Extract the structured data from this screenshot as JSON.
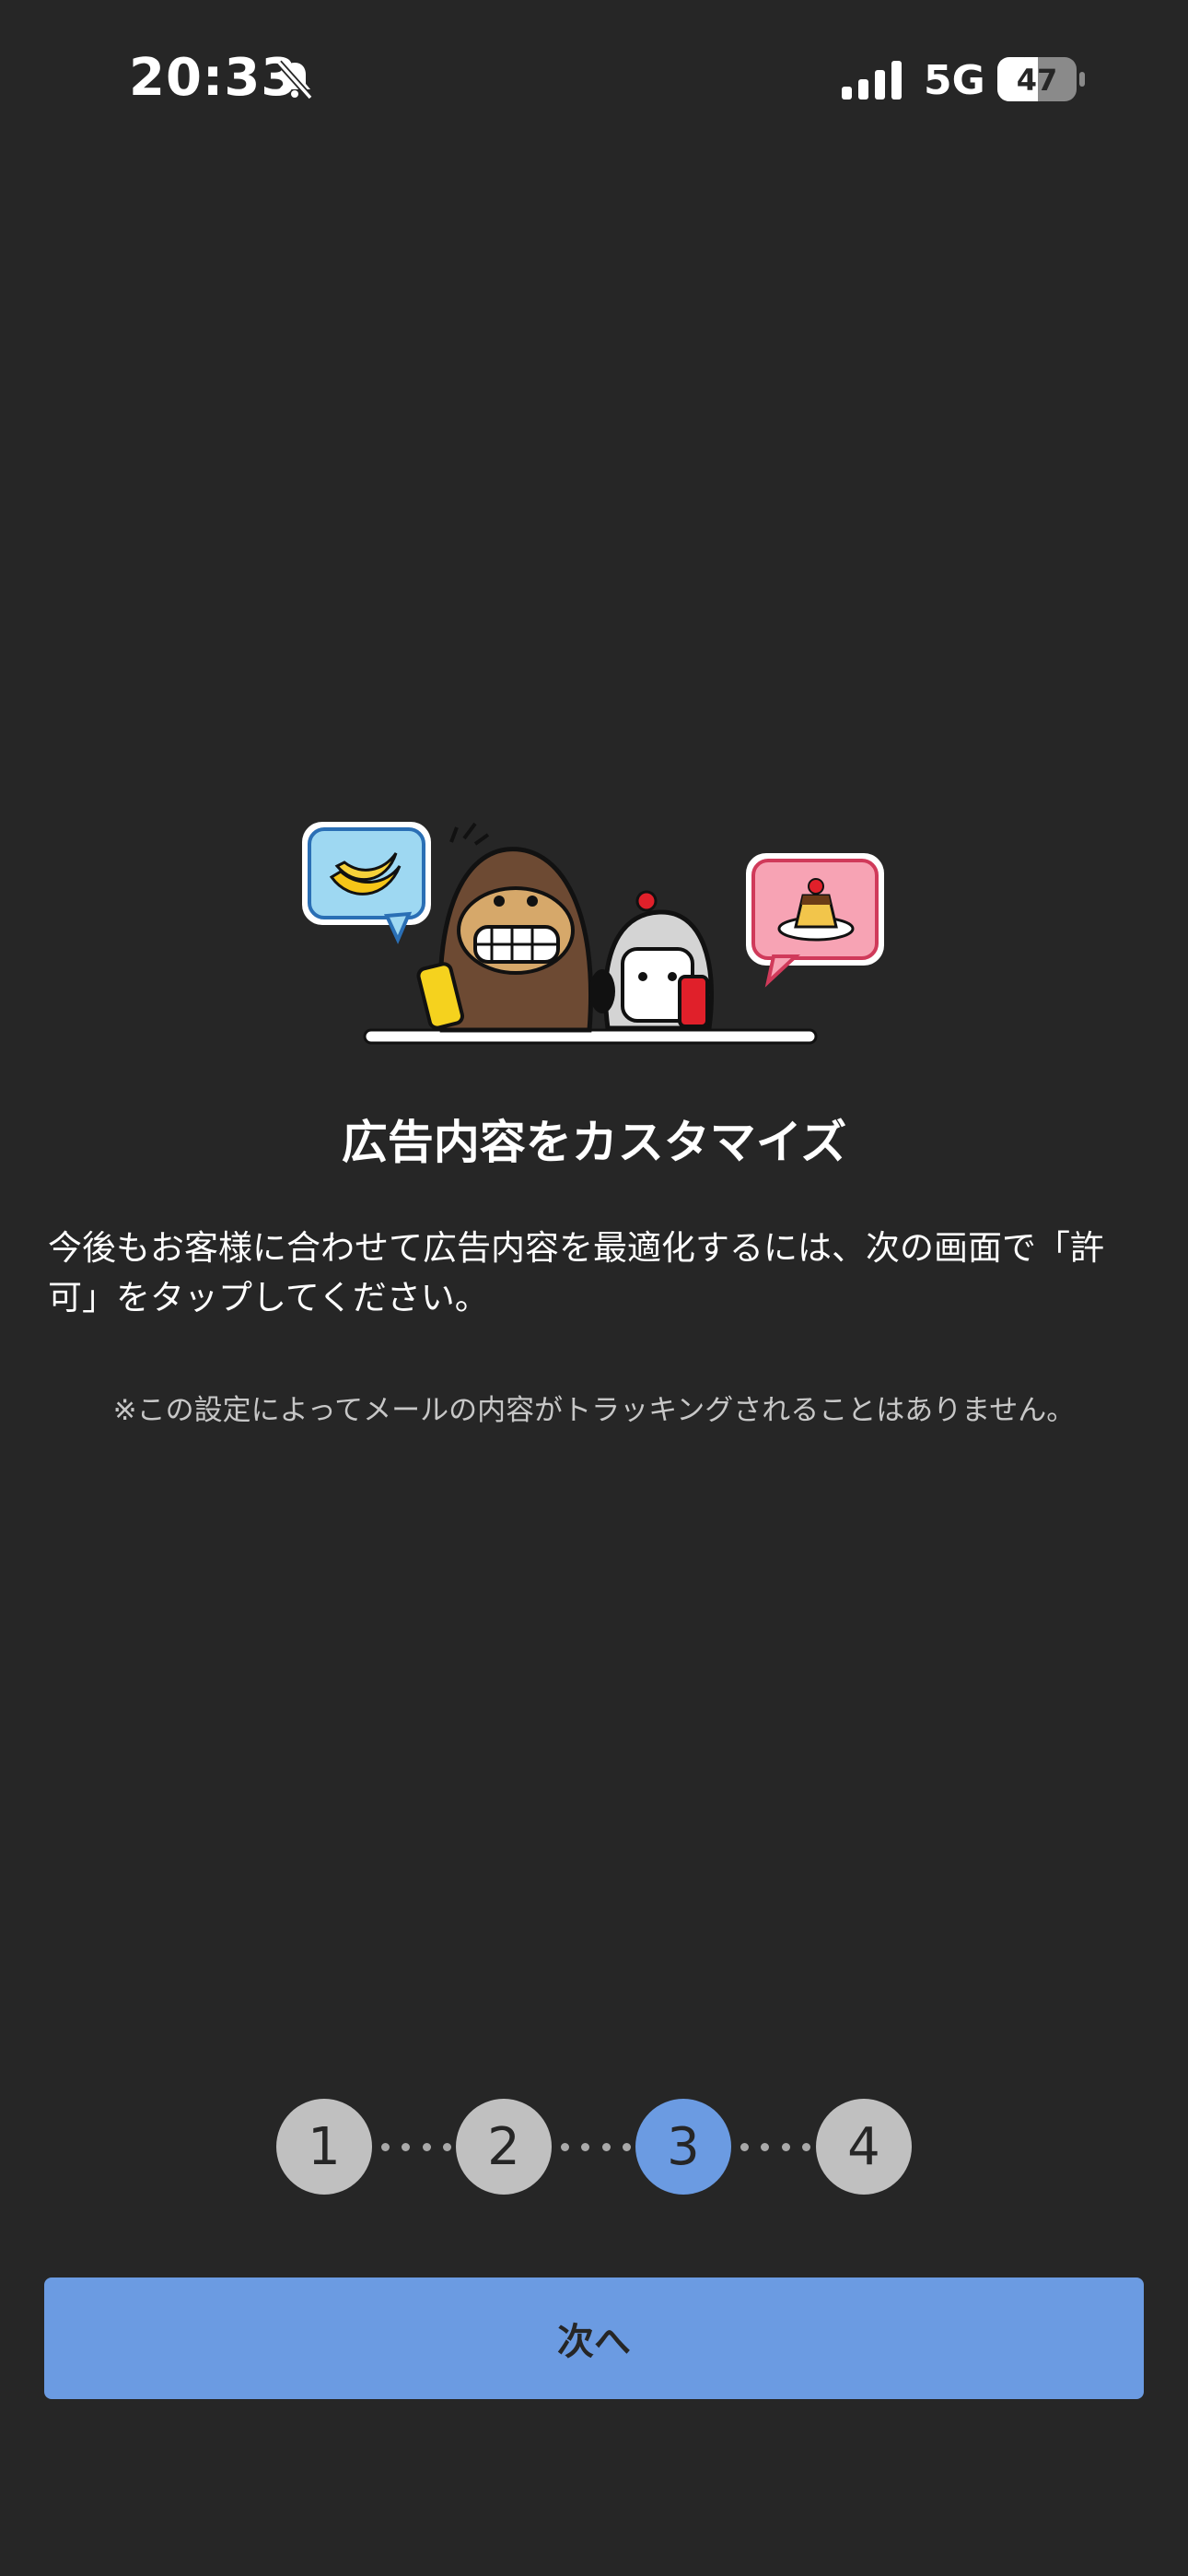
{
  "status_bar": {
    "time": "20:33",
    "network": "5G",
    "battery": "47",
    "icons": [
      "bell-slash-icon",
      "signal-icon",
      "battery-icon"
    ]
  },
  "main": {
    "title": "広告内容をカスタマイズ",
    "description": "今後もお客様に合わせて広告内容を最適化するには、次の画面で「許可」をタップしてください。",
    "note": "※この設定によってメールの内容がトラッキングされることはありません。"
  },
  "stepper": {
    "steps": [
      "1",
      "2",
      "3",
      "4"
    ],
    "active_step": "3"
  },
  "footer": {
    "next_label": "次へ"
  },
  "colors": {
    "background": "#262626",
    "accent": "#6b9be2",
    "inactive_step": "#c0c0c0"
  }
}
